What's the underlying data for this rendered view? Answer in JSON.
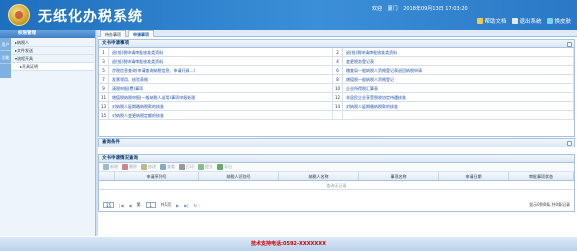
{
  "header": {
    "app_title": "无纸化办税系统",
    "info_items": [
      "欢迎",
      "厦门",
      "2018年09月13日 17:03:20"
    ],
    "links": [
      "帮助文档",
      "退出系统",
      "换皮肤"
    ]
  },
  "sidebar": {
    "title": "权限管理",
    "vtabs": [
      "用户",
      "功能"
    ],
    "items": [
      "▸纳税人",
      "▸文件发送",
      "▾流程开具",
      "▸开具证明"
    ]
  },
  "tabs": [
    "待办事项",
    "申请事项"
  ],
  "pane_application": {
    "title": "文书申请事项",
    "rows": [
      {
        "n1": "1",
        "t1": "退(抵)税申请审批核准类资料",
        "n2": "2",
        "t2": "退(抵)税申请审批核准类资料"
      },
      {
        "n1": "3",
        "t1": "退(抵)税申请审批核准类资料",
        "n2": "4",
        "t2": "变更税务登记表"
      },
      {
        "n1": "5",
        "t1": "涉税信息查询(申请查询纳税信息、申请开具...)",
        "n2": "6",
        "t2": "稽查局一般纳税人资格登记表退回纳税申请"
      },
      {
        "n1": "7",
        "t1": "发票领用、核验表格",
        "n2": "8",
        "t2": "增值税一般纳税人资格登记"
      },
      {
        "n1": "9",
        "t1": "清税申报(费)事项",
        "n2": "10",
        "t2": "企业所得税汇算表"
      },
      {
        "n1": "11",
        "t1": "增值税纳税申报(一般纳税人适用)事项申报处理",
        "n2": "12",
        "t2": "非居民企业享受税收协定待遇核准"
      },
      {
        "n1": "13",
        "t1": "对纳税人延期缴纳税款的核准",
        "n2": "14",
        "t2": "对纳税人延期缴纳税款的核准"
      },
      {
        "n1": "15",
        "t1": "对纳税人变更纳税定额的核准",
        "n2": "",
        "t2": ""
      }
    ]
  },
  "pane_query": {
    "title": "查询条件"
  },
  "pane_list": {
    "title": "文书申请情况查询",
    "toolbar": [
      "新增",
      "删除",
      "修改",
      "查看",
      "打印",
      "提交",
      "导出"
    ],
    "columns": [
      "申请序列号",
      "纳税人识别号",
      "纳税人名称",
      "事项名称",
      "申请日期",
      "审批事项状态"
    ],
    "empty": "查询无记录"
  },
  "pager": {
    "size": "15",
    "first": "|◀",
    "prev": "◀",
    "page_label": "第",
    "page": "1",
    "of": "共1页",
    "next": "▶",
    "last": "▶|",
    "refresh": "↻",
    "info": "显示0到0条,共0条记录"
  },
  "footer": {
    "hotline": "技术支持电话:0592-XXXXXXX"
  },
  "colors": {
    "header": "#2a78c6",
    "accent": "#1f4fa5",
    "footer_text": "#d10000"
  }
}
